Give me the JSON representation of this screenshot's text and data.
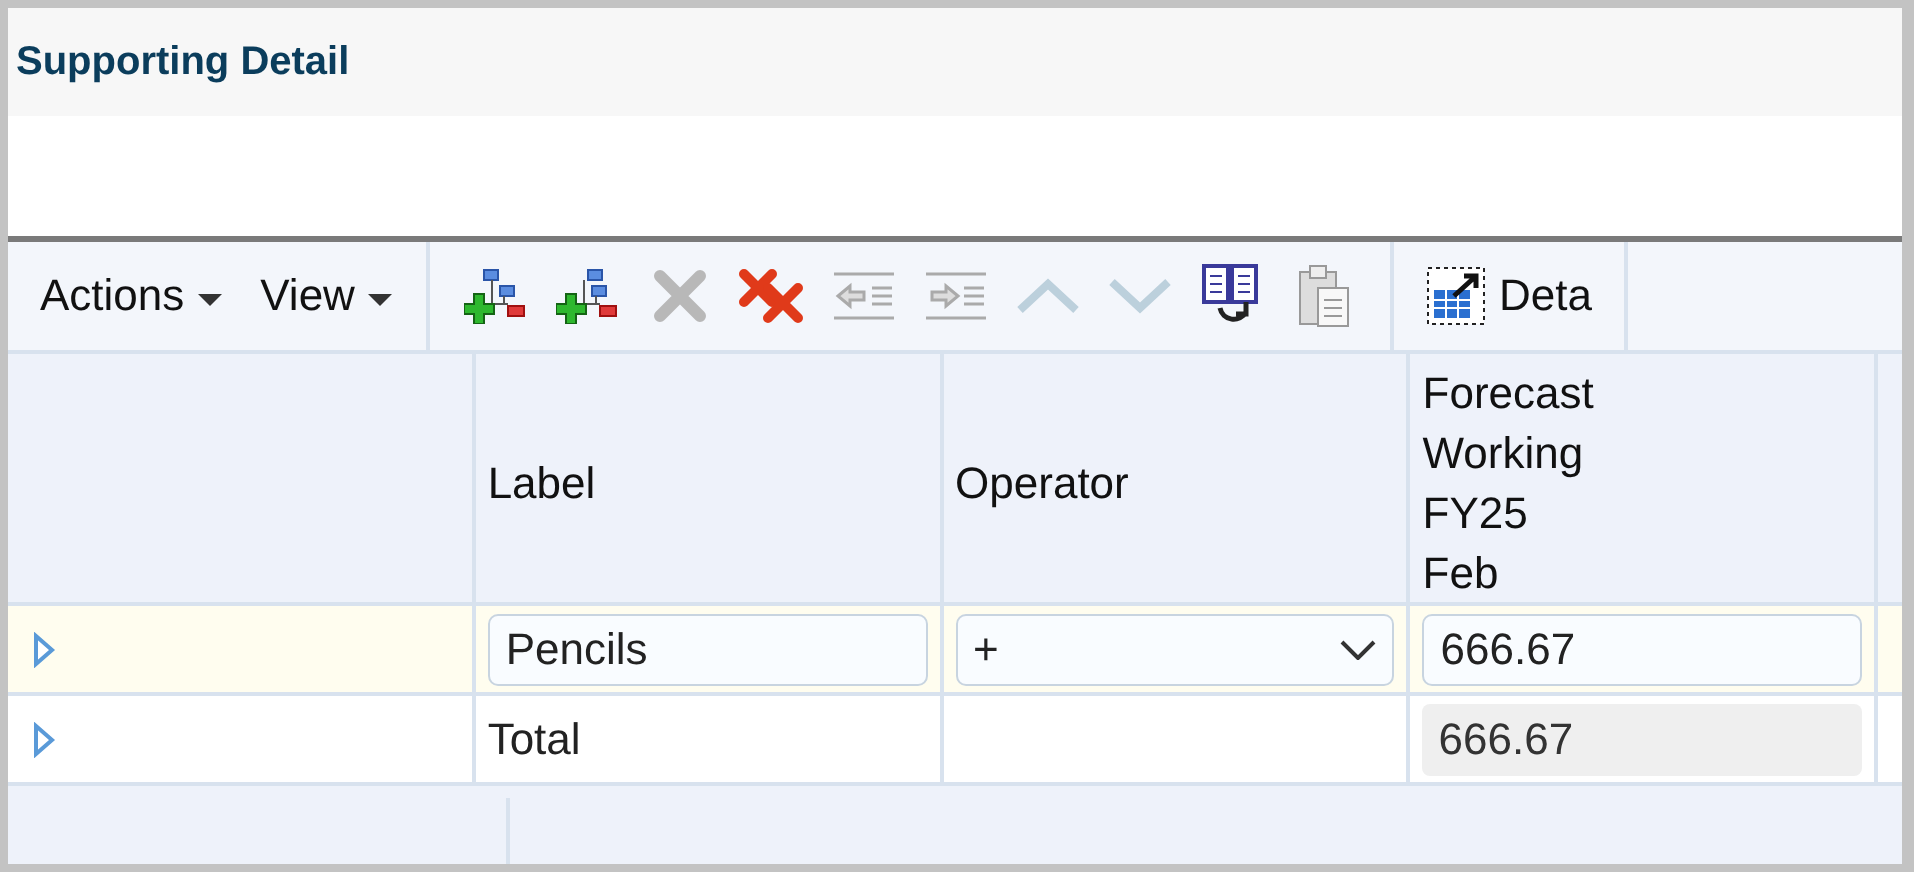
{
  "title": "Supporting Detail",
  "toolbar": {
    "menus": [
      {
        "label": "Actions"
      },
      {
        "label": "View"
      }
    ],
    "tools": [
      {
        "kind": "add-sibling",
        "disabled": false
      },
      {
        "kind": "add-child",
        "disabled": false
      },
      {
        "kind": "delete",
        "disabled": true
      },
      {
        "kind": "delete-all",
        "disabled": false
      },
      {
        "kind": "outdent",
        "disabled": true
      },
      {
        "kind": "indent",
        "disabled": true
      },
      {
        "kind": "move-up",
        "disabled": true
      },
      {
        "kind": "move-down",
        "disabled": true
      },
      {
        "kind": "copy",
        "disabled": false
      },
      {
        "kind": "paste",
        "disabled": true
      }
    ],
    "detach": {
      "label": "Deta"
    }
  },
  "table": {
    "columns": [
      "Label",
      "Operator",
      "Forecast\nWorking\nFY25\nFeb"
    ],
    "rows": [
      {
        "kind": "entry",
        "selected": true,
        "label": "Pencils",
        "operator": "+",
        "value": "666.67"
      },
      {
        "kind": "total",
        "selected": false,
        "label": "Total",
        "value": "666.67"
      }
    ]
  }
}
